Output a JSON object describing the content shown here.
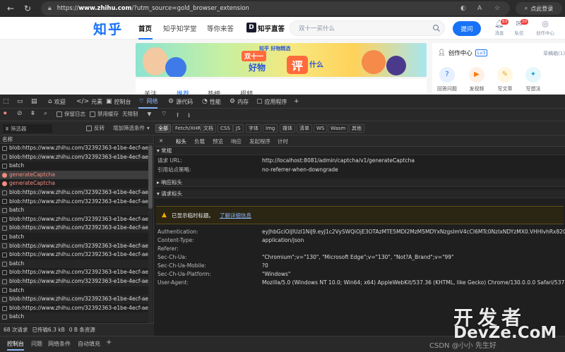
{
  "browser": {
    "url_prefix": "https://",
    "url_host": "www.zhihu.com",
    "url_rest": "/?utm_source=gold_browser_extension",
    "login_label": "点此登录"
  },
  "zhihu": {
    "logo": "知乎",
    "nav": [
      "首页",
      "知乎知学堂",
      "等你来答",
      "知乎直答"
    ],
    "search_placeholder": "双十一买什么",
    "ask_button": "提问",
    "header_icons": [
      {
        "label": "消息",
        "badge": "63"
      },
      {
        "label": "私信",
        "badge": "20"
      },
      {
        "label": "创作中心",
        "badge": ""
      }
    ],
    "banner": {
      "tag": "知乎 好物精选",
      "line1": "双十一",
      "line2": "好物",
      "big": "评",
      "line3": "什么"
    },
    "feed_tabs": [
      "关注",
      "推荐",
      "热榜",
      "视频"
    ],
    "creator": {
      "title": "创作中心",
      "level": "Lv3",
      "drafts": "草稿箱(1)",
      "tools": [
        {
          "label": "回答问题",
          "icon": "question-icon",
          "color": "#e6f0ff",
          "fg": "#1772f6"
        },
        {
          "label": "发视频",
          "icon": "video-icon",
          "color": "#fff0e6",
          "fg": "#ff7a00"
        },
        {
          "label": "写文章",
          "icon": "pen-icon",
          "color": "#fff7e0",
          "fg": "#f5a623"
        },
        {
          "label": "写想法",
          "icon": "idea-icon",
          "color": "#e6f7fb",
          "fg": "#18a9d0"
        }
      ]
    }
  },
  "devtools": {
    "tabs": [
      {
        "label": "欢迎",
        "icon": "home-icon"
      },
      {
        "label": "元素",
        "icon": "code-icon"
      },
      {
        "label": "控制台",
        "icon": "console-icon"
      },
      {
        "label": "网络",
        "icon": "wifi-icon"
      },
      {
        "label": "源代码",
        "icon": "sources-icon"
      },
      {
        "label": "性能",
        "icon": "performance-icon"
      },
      {
        "label": "内存",
        "icon": "memory-icon"
      },
      {
        "label": "应用程序",
        "icon": "app-icon"
      }
    ],
    "toolbar": {
      "preserve_log": "保留日志",
      "disable_cache": "禁用缓存",
      "throttle": "无限制"
    },
    "filter": {
      "placeholder": "筛选器",
      "invert": "反转",
      "more_filters": "增加筛选条件",
      "types": [
        "全部",
        "Fetch/XHR",
        "文档",
        "CSS",
        "JS",
        "字体",
        "Img",
        "媒体",
        "清单",
        "WS",
        "Wasm",
        "其他"
      ]
    },
    "list_header": "名称",
    "requests": [
      {
        "name": "blob:https://www.zhihu.com/32392363-e1be-4ecf-aef0-1f2...",
        "kind": "blob"
      },
      {
        "name": "blob:https://www.zhihu.com/32392363-e1be-4ecf-aef0-1f2...",
        "kind": "blob"
      },
      {
        "name": "batch",
        "kind": "blob"
      },
      {
        "name": "generateCaptcha",
        "kind": "err"
      },
      {
        "name": "generateCaptcha",
        "kind": "err"
      },
      {
        "name": "blob:https://www.zhihu.com/32392363-e1be-4ecf-aef0-1f2...",
        "kind": "blob"
      },
      {
        "name": "blob:https://www.zhihu.com/32392363-e1be-4ecf-aef0-1f2...",
        "kind": "blob"
      },
      {
        "name": "batch",
        "kind": "blob"
      },
      {
        "name": "blob:https://www.zhihu.com/32392363-e1be-4ecf-aef0-1f2...",
        "kind": "blob"
      },
      {
        "name": "blob:https://www.zhihu.com/32392363-e1be-4ecf-aef0-1f2...",
        "kind": "blob"
      },
      {
        "name": "batch",
        "kind": "blob"
      },
      {
        "name": "blob:https://www.zhihu.com/32392363-e1be-4ecf-aef0-1f2...",
        "kind": "blob"
      },
      {
        "name": "blob:https://www.zhihu.com/32392363-e1be-4ecf-aef0-1f2...",
        "kind": "blob"
      },
      {
        "name": "batch",
        "kind": "blob"
      },
      {
        "name": "blob:https://www.zhihu.com/32392363-e1be-4ecf-aef0-1f2...",
        "kind": "blob"
      },
      {
        "name": "blob:https://www.zhihu.com/32392363-e1be-4ecf-aef0-1f2...",
        "kind": "blob"
      },
      {
        "name": "batch",
        "kind": "blob"
      },
      {
        "name": "blob:https://www.zhihu.com/32392363-e1be-4ecf-aef0-1f2...",
        "kind": "blob"
      },
      {
        "name": "blob:https://www.zhihu.com/32392363-e1be-4ecf-aef0-1f2...",
        "kind": "blob"
      },
      {
        "name": "batch",
        "kind": "blob"
      }
    ],
    "detail_tabs": [
      "标头",
      "负载",
      "预览",
      "响应",
      "发起程序",
      "计时"
    ],
    "general": {
      "title": "常规",
      "rows": [
        {
          "k": "请求 URL:",
          "v": "http://localhost:8081/admin/captcha/v1/generateCaptcha"
        },
        {
          "k": "引用站点策略:",
          "v": "no-referrer-when-downgrade"
        }
      ]
    },
    "response_headers_title": "响应标头",
    "request_headers_title": "请求标头",
    "warning": {
      "text": "已显示临时标题。",
      "link": "了解详细信息"
    },
    "request_headers": [
      {
        "k": "Authentication:",
        "v": "eyJhbGciOiJIUzI1NiJ9.eyJ1c2VySWQiOjE3OTAzMTE5MDI2MzM5MDYxNzgsImV4cCI6MTc0NzIxNDYzMX0.VHHIvhRx82G8YBkoQV3qZNSn"
      },
      {
        "k": "Content-Type:",
        "v": "application/json"
      },
      {
        "k": "Referer:",
        "v": ""
      },
      {
        "k": "Sec-Ch-Ua:",
        "v": "\"Chromium\";v=\"130\", \"Microsoft Edge\";v=\"130\", \"Not?A_Brand\";v=\"99\""
      },
      {
        "k": "Sec-Ch-Ua-Mobile:",
        "v": "?0"
      },
      {
        "k": "Sec-Ch-Ua-Platform:",
        "v": "\"Windows\""
      },
      {
        "k": "User-Agent:",
        "v": "Mozilla/5.0 (Windows NT 10.0; Win64; x64) AppleWebKit/537.36 (KHTML, like Gecko) Chrome/130.0.0.0 Safari/537.36"
      }
    ],
    "status": {
      "requests": "68 次请求",
      "transferred": "已传输6.3 kB",
      "resources": "0 B 条资源"
    },
    "drawer_tabs": [
      "控制台",
      "问题",
      "网络条件",
      "自动填充"
    ]
  },
  "watermark": {
    "line1": "开发者",
    "line2": "DevZe.CoM",
    "line3": "CSDN @小小 先生好"
  }
}
